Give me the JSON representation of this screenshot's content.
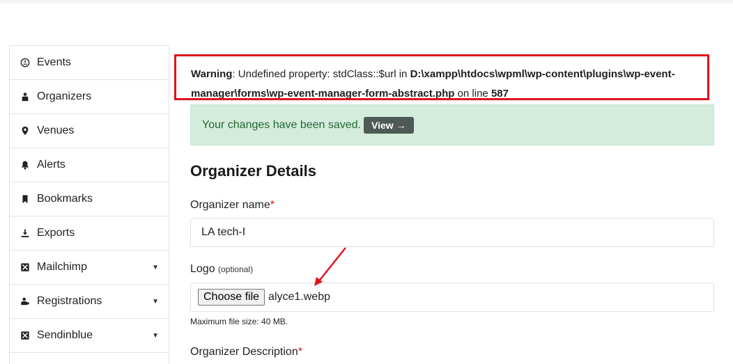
{
  "sidebar": {
    "items": [
      {
        "label": "Events",
        "icon": "dashboard-icon",
        "has_caret": false
      },
      {
        "label": "Organizers",
        "icon": "person-icon",
        "has_caret": false
      },
      {
        "label": "Venues",
        "icon": "location-pin-icon",
        "has_caret": false
      },
      {
        "label": "Alerts",
        "icon": "bell-icon",
        "has_caret": false
      },
      {
        "label": "Bookmarks",
        "icon": "bookmark-icon",
        "has_caret": false
      },
      {
        "label": "Exports",
        "icon": "download-icon",
        "has_caret": false
      },
      {
        "label": "Mailchimp",
        "icon": "mail-x-icon",
        "has_caret": true
      },
      {
        "label": "Registrations",
        "icon": "users-icon",
        "has_caret": true
      },
      {
        "label": "Sendinblue",
        "icon": "mail-x-icon",
        "has_caret": true
      }
    ],
    "caret": "▼"
  },
  "warning": {
    "label": "Warning",
    "message": ": Undefined property: stdClass::$url in ",
    "path": "D:\\xampp\\htdocs\\wpml\\wp-content\\plugins\\wp-event-manager\\forms\\wp-event-manager-form-abstract.php",
    "on_line": " on line ",
    "line": "587"
  },
  "notice": {
    "message": "Your changes have been saved.",
    "view_label": "View →"
  },
  "form": {
    "title": "Organizer Details",
    "name_label": "Organizer name",
    "name_value": "LA tech-I",
    "logo_label": "Logo",
    "logo_optional": "(optional)",
    "choose_file_label": "Choose file",
    "file_name": "alyce1.webp",
    "max_size_hint": "Maximum file size: 40 MB.",
    "description_label": "Organizer Description",
    "required_mark": "*"
  },
  "colors": {
    "warning_border": "#e0101a",
    "notice_bg": "#d4ecdb",
    "notice_text": "#246936",
    "view_button_bg": "#4e5a55",
    "annotation_arrow": "#e0101a"
  }
}
